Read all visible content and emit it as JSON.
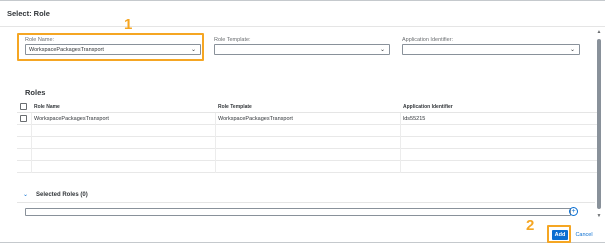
{
  "dialog": {
    "title": "Select: Role"
  },
  "filters": {
    "role_name": {
      "label": "Role Name:",
      "value": "WorkspacePackagesTransport"
    },
    "role_template": {
      "label": "Role Template:",
      "value": ""
    },
    "application_identifier": {
      "label": "Application Identifier:",
      "value": ""
    }
  },
  "annotations": {
    "step1": "1",
    "step2": "2"
  },
  "roles": {
    "title": "Roles",
    "columns": [
      "Role Name",
      "Role Template",
      "Application Identifier"
    ],
    "rows": [
      {
        "role_name": "WorkspacePackagesTransport",
        "role_template": "WorkspacePackagesTransport",
        "app_id": "lds55215"
      }
    ]
  },
  "selected_roles": {
    "title": "Selected Roles (0)"
  },
  "footer": {
    "add_label": "Add",
    "cancel_label": "Cancel"
  },
  "colors": {
    "accent": "#0a6ed1",
    "highlight": "#f5a623"
  }
}
